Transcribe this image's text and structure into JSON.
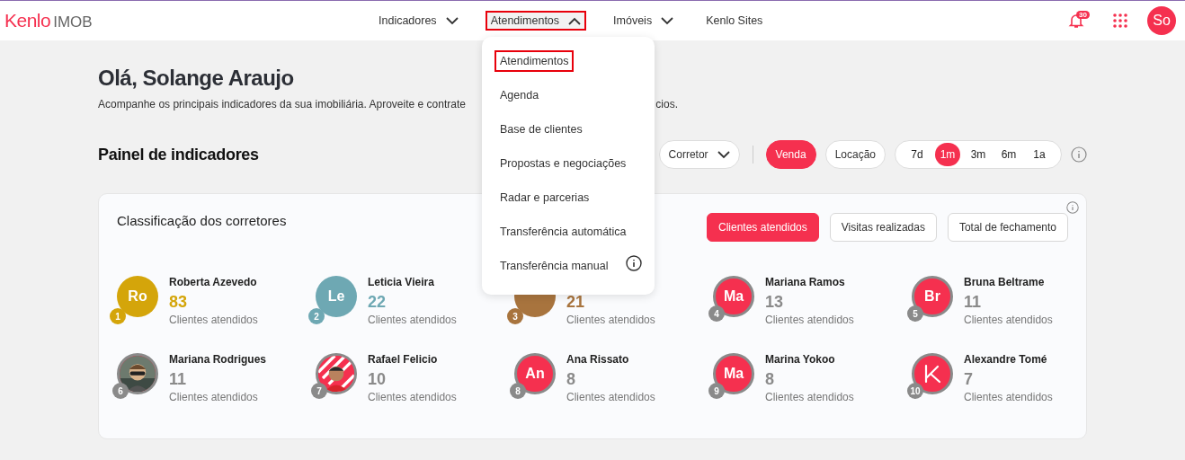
{
  "brand": {
    "name": "Kenlo",
    "product": "IMOB"
  },
  "nav": [
    {
      "label": "Indicadores",
      "kind": "menu",
      "expanded": false,
      "highlighted": false
    },
    {
      "label": "Atendimentos",
      "kind": "menu",
      "expanded": true,
      "highlighted": true
    },
    {
      "label": "Imóveis",
      "kind": "menu",
      "expanded": false,
      "highlighted": false
    },
    {
      "label": "Kenlo Sites",
      "kind": "link",
      "expanded": false,
      "highlighted": false
    }
  ],
  "notifications": {
    "count": "30"
  },
  "user": {
    "initials": "So"
  },
  "dropdown": [
    {
      "label": "Atendimentos",
      "highlighted": true,
      "info": false
    },
    {
      "label": "Agenda",
      "highlighted": false,
      "info": false
    },
    {
      "label": "Base de clientes",
      "highlighted": false,
      "info": false
    },
    {
      "label": "Propostas e negociações",
      "highlighted": false,
      "info": false
    },
    {
      "label": "Radar e parcerias",
      "highlighted": false,
      "info": false
    },
    {
      "label": "Transferência automática",
      "highlighted": false,
      "info": false
    },
    {
      "label": "Transferência manual",
      "highlighted": false,
      "info": true
    }
  ],
  "greeting": "Olá, Solange Araujo",
  "subtitle_start": "Acompanhe os principais indicadores da sua imobiliária. Aproveite e contrate",
  "subtitle_end": "cios.",
  "panel": {
    "title": "Painel de indicadores",
    "filter": {
      "label": "Corretor"
    },
    "business": [
      {
        "label": "Venda",
        "selected": true
      },
      {
        "label": "Locação",
        "selected": false
      }
    ],
    "periods": [
      {
        "label": "7d",
        "selected": false
      },
      {
        "label": "1m",
        "selected": true
      },
      {
        "label": "3m",
        "selected": false
      },
      {
        "label": "6m",
        "selected": false
      },
      {
        "label": "1a",
        "selected": false
      }
    ]
  },
  "ranking": {
    "title": "Classificação dos corretores",
    "metrics": [
      {
        "label": "Clientes atendidos",
        "selected": true
      },
      {
        "label": "Visitas realizadas",
        "selected": false
      },
      {
        "label": "Total de fechamento",
        "selected": false
      }
    ],
    "agents": [
      {
        "rank": "1",
        "name": "Roberta Azevedo",
        "value": "83",
        "caption": "Clientes atendidos",
        "kind": "initials",
        "initials": "Ro",
        "color": "#d4a50a"
      },
      {
        "rank": "2",
        "name": "Leticia Vieira",
        "value": "22",
        "caption": "Clientes atendidos",
        "kind": "initials",
        "initials": "Le",
        "color": "#6ea8b3"
      },
      {
        "rank": "3",
        "value": "21",
        "caption": "Clientes atendidos",
        "kind": "initials",
        "color": "#a8743e"
      },
      {
        "rank": "4",
        "name": "Mariana Ramos",
        "value": "13",
        "caption": "Clientes atendidos",
        "kind": "initials",
        "initials": "Ma",
        "color": "#8a8a8a"
      },
      {
        "rank": "5",
        "name": "Bruna Beltrame",
        "value": "11",
        "caption": "Clientes atendidos",
        "kind": "initials",
        "initials": "Br",
        "color": "#8a8a8a"
      },
      {
        "rank": "6",
        "name": "Mariana Rodrigues",
        "value": "11",
        "caption": "Clientes atendidos",
        "color": "#8a8a8a"
      },
      {
        "rank": "7",
        "name": "Rafael Felicio",
        "value": "10",
        "caption": "Clientes atendidos",
        "color": "#8a8a8a"
      },
      {
        "rank": "8",
        "name": "Ana Rissato",
        "value": "8",
        "caption": "Clientes atendidos",
        "kind": "initials",
        "initials": "An",
        "color": "#8a8a8a"
      },
      {
        "rank": "9",
        "name": "Marina Yokoo",
        "value": "8",
        "caption": "Clientes atendidos",
        "kind": "initials",
        "initials": "Ma",
        "color": "#8a8a8a"
      },
      {
        "rank": "10",
        "name": "Alexandre Tomé",
        "value": "7",
        "caption": "Clientes atendidos",
        "kind": "logo",
        "color": "#8a8a8a"
      }
    ]
  }
}
